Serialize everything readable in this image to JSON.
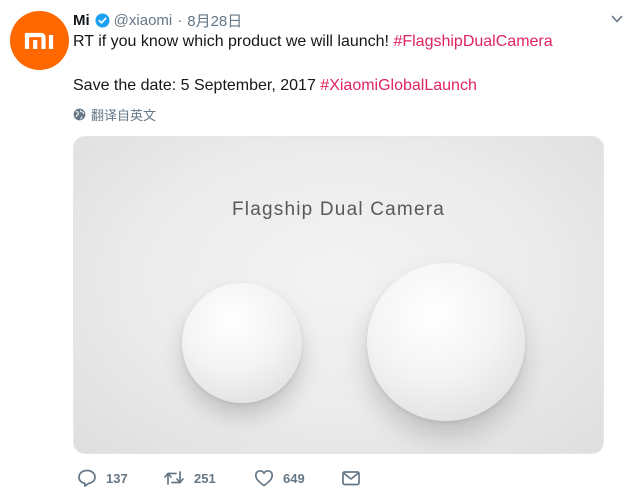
{
  "tweet": {
    "author_name": "Mi",
    "handle": "@xiaomi",
    "separator": "·",
    "date": "8月28日",
    "line1_text": "RT if you know which product we will launch! ",
    "line1_hashtag": "#FlagshipDualCamera",
    "line2_text": "Save the date: 5 September, 2017 ",
    "line2_hashtag": "#XiaomiGlobalLaunch",
    "translate_label": "翻译自英文"
  },
  "media": {
    "title": "Flagship Dual Camera"
  },
  "actions": {
    "reply_count": "137",
    "retweet_count": "251",
    "like_count": "649"
  },
  "colors": {
    "brand_orange": "#ff6700",
    "hashtag": "#e0245e",
    "verified_blue": "#1da1f2",
    "muted": "#657786"
  },
  "icons": {
    "avatar": "mi-logo",
    "verified": "verified-badge-icon",
    "caret": "chevron-down-icon",
    "translate": "globe-icon",
    "reply": "reply-icon",
    "retweet": "retweet-icon",
    "like": "heart-icon",
    "dm": "envelope-icon"
  }
}
